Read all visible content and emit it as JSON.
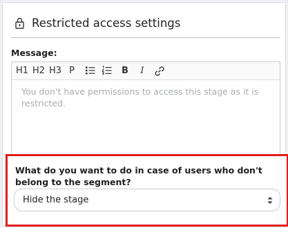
{
  "header": {
    "title": "Restricted access settings",
    "icon": "lock-icon"
  },
  "message": {
    "label": "Message:",
    "placeholder": "You don't have permissions to access this stage as it is restricted."
  },
  "toolbar": {
    "h1": "H1",
    "h2": "H2",
    "h3": "H3",
    "p": "P",
    "bullet_icon": "bulleted-list-icon",
    "numbered_icon": "numbered-list-icon",
    "bold": "B",
    "italic": "I",
    "link_icon": "link-icon"
  },
  "fallback": {
    "question": "What do you want to do in case of users who don't belong to the segment?",
    "selected": "Hide the stage"
  },
  "colors": {
    "highlight": "#e31b1b",
    "border": "#c9ccd1",
    "placeholder": "#a9acb2"
  }
}
